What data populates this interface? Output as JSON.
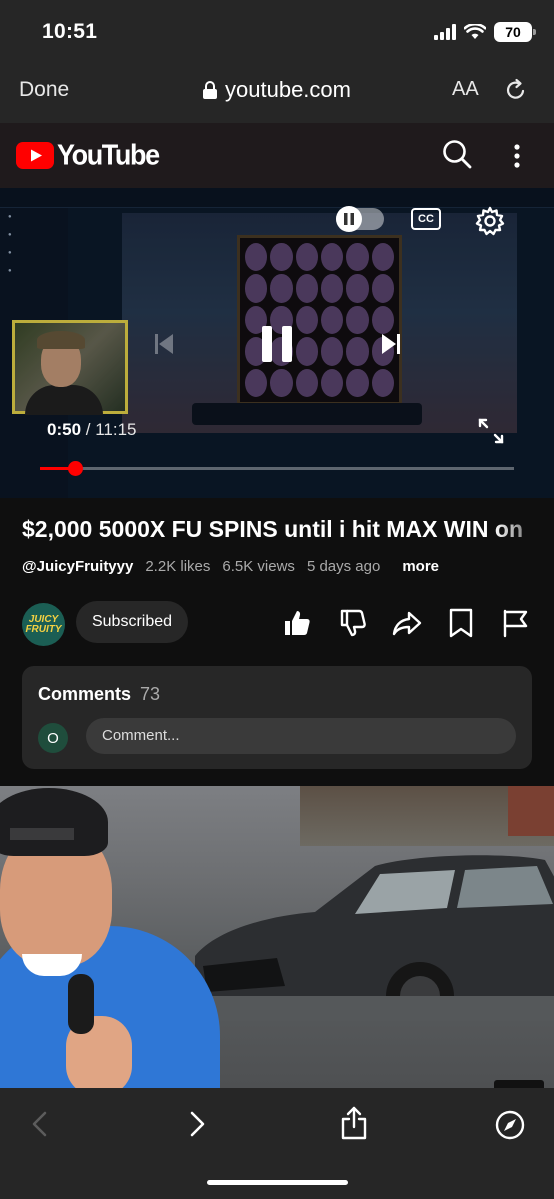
{
  "status_bar": {
    "time": "10:51",
    "battery": "70"
  },
  "browser": {
    "done_label": "Done",
    "url": "youtube.com",
    "aa_label": "AA"
  },
  "youtube": {
    "logo_text": "YouTube"
  },
  "player": {
    "current_time": "0:50",
    "separator": "/",
    "duration": "11:15",
    "progress": 0.0741,
    "cc_label": "CC",
    "webcam_caption": ""
  },
  "video": {
    "title": "$2,000 5000X FU SPINS until i hit MAX WIN on",
    "channel": "@JuicyFruityyy",
    "likes": "2.2K likes",
    "views": "6.5K views",
    "age": "5 days ago",
    "more_label": "more",
    "avatar_text": "JUICY FRUITY",
    "subscribed_label": "Subscribed"
  },
  "comments": {
    "title": "Comments",
    "count": "73",
    "user_initial": "O",
    "placeholder": "Comment..."
  },
  "colors": {
    "accent": "#ff0000",
    "background": "#0f0f0f",
    "chrome": "#262626"
  }
}
